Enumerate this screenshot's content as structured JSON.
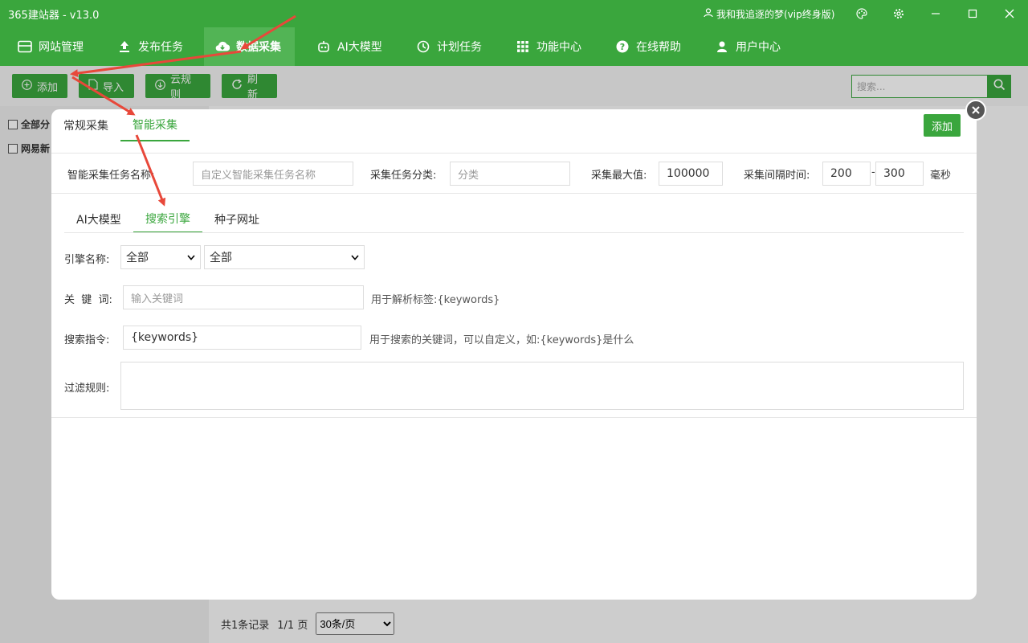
{
  "window": {
    "title": "365建站器 - v13.0",
    "user": "我和我追逐的梦(vip终身版)",
    "icons": [
      "user-icon",
      "palette-icon",
      "gear-icon",
      "minimize-icon",
      "maximize-icon",
      "close-icon"
    ]
  },
  "nav": {
    "items": [
      {
        "label": "网站管理",
        "icon": "website-icon"
      },
      {
        "label": "发布任务",
        "icon": "upload-icon"
      },
      {
        "label": "数据采集",
        "icon": "cloud-download-icon",
        "active": true
      },
      {
        "label": "AI大模型",
        "icon": "robot-icon"
      },
      {
        "label": "计划任务",
        "icon": "clock-icon"
      },
      {
        "label": "功能中心",
        "icon": "grid-icon"
      },
      {
        "label": "在线帮助",
        "icon": "help-icon"
      },
      {
        "label": "用户中心",
        "icon": "user-icon"
      }
    ]
  },
  "toolbar": {
    "add": "添加",
    "import": "导入",
    "cloud_rules": "云规则",
    "refresh": "刷新",
    "search_placeholder": "搜索..."
  },
  "sidebar": {
    "categories": [
      "全部分",
      "网易新"
    ]
  },
  "pager": {
    "total": "共1条记录",
    "pages": "1/1 页",
    "per_page": "30条/页"
  },
  "modal": {
    "tabs": [
      "常规采集",
      "智能采集"
    ],
    "active_tab": "智能采集",
    "add_button": "添加",
    "task_name_label": "智能采集任务名称:",
    "task_name_placeholder": "自定义智能采集任务名称",
    "category_label": "采集任务分类:",
    "category_placeholder": "分类",
    "max_label": "采集最大值:",
    "max_value": "100000",
    "interval_label": "采集间隔时间:",
    "interval_min": "200",
    "interval_sep": "-",
    "interval_max": "300",
    "interval_unit": "毫秒",
    "sub_tabs": [
      "AI大模型",
      "搜索引擎",
      "种子网址"
    ],
    "active_sub_tab": "搜索引擎",
    "engine_label": "引擎名称:",
    "engine_select1": "全部",
    "engine_select2": "全部",
    "keyword_label": "关  键  词:",
    "keyword_placeholder": "输入关键词",
    "keyword_hint": "用于解析标签:{keywords}",
    "command_label": "搜索指令:",
    "command_value": "{keywords}",
    "command_hint": "用于搜索的关键词，可以自定义，如:{keywords}是什么",
    "filter_label": "过滤规则:"
  },
  "colors": {
    "brand": "#3aa63d",
    "annotation_arrow": "#e8483a"
  }
}
